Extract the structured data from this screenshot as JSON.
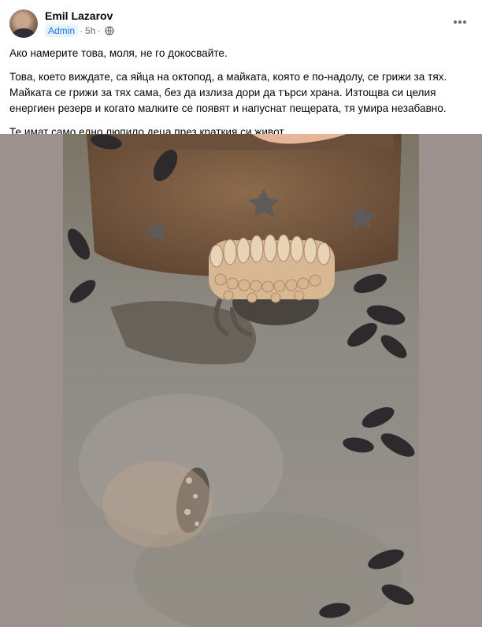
{
  "post": {
    "author": "Emil Lazarov",
    "role_badge": "Admin",
    "time": "5h",
    "audience_icon": "globe-icon",
    "more_icon": "more-options-icon",
    "paragraphs": [
      "Ако намерите това, моля, не го докосвайте.",
      "Това, което виждате, са яйца на октопод, а майката, която е по-надолу, се грижи за тях. Майката се грижи за тях сама, без да излиза дори да търси храна. Изтощва си целия енергиен резерв и когато малките се появят и напуснат пещерата, тя умира незабавно.",
      "Те имат само едно люпило деца през краткия си живот."
    ]
  },
  "colors": {
    "badge_bg": "#e7f3ff",
    "badge_text": "#1877f2",
    "media_background": "#9c918f"
  }
}
